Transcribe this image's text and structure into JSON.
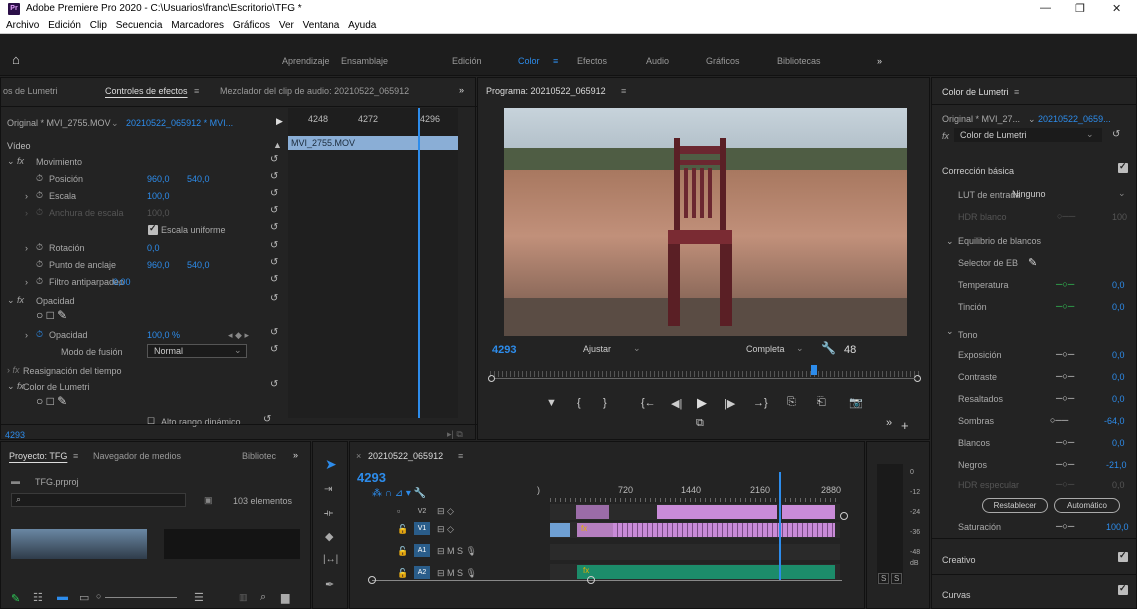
{
  "titlebar": {
    "app_icon": "Pr",
    "title": "Adobe Premiere Pro 2020 - C:\\Usuarios\\franc\\Escritorio\\TFG *",
    "minimize": "—",
    "maximize": "❐",
    "close": "✕"
  },
  "menu": [
    "Archivo",
    "Edición",
    "Clip",
    "Secuencia",
    "Marcadores",
    "Gráficos",
    "Ver",
    "Ventana",
    "Ayuda"
  ],
  "workspaces": {
    "home_icon": "⌂",
    "items": [
      "Aprendizaje",
      "Ensamblaje",
      "Edición",
      "Color",
      "Efectos",
      "Audio",
      "Gráficos",
      "Bibliotecas"
    ],
    "active": "Color",
    "more": "»"
  },
  "effects_panel": {
    "tabs": [
      "os de Lumetri",
      "Controles de efectos",
      "Mezclador del clip de audio: 20210522_065912"
    ],
    "active_tab": "Controles de efectos",
    "menu_icon": "≡",
    "more": "»",
    "source_clip": "Original * MVI_2755.MOV",
    "sequence_clip": "20210522_065912 * MVI...",
    "timecodes": [
      "4248",
      "4272",
      "4296"
    ],
    "timeline_clip": "MVI_2755.MOV",
    "section_video": "Vídeo",
    "motion": {
      "label": "Movimiento",
      "position_label": "Posición",
      "position_x": "960,0",
      "position_y": "540,0",
      "scale_label": "Escala",
      "scale_value": "100,0",
      "scale_width_label": "Anchura de escala",
      "scale_width_value": "100,0",
      "uniform_label": "Escala uniforme",
      "rotation_label": "Rotación",
      "rotation_value": "0,0",
      "anchor_label": "Punto de anclaje",
      "anchor_x": "960,0",
      "anchor_y": "540,0",
      "flicker_label": "Filtro antiparpadeo",
      "flicker_value": "0,00"
    },
    "opacity": {
      "label": "Opacidad",
      "opacity_label": "Opacidad",
      "opacity_value": "100,0 %",
      "blend_label": "Modo de fusión",
      "blend_value": "Normal"
    },
    "time_remap": "Reasignación del tiempo",
    "lumetri": "Color de Lumetri",
    "hdr_label": "Alto rango dinámico",
    "current_time": "4293"
  },
  "program_monitor": {
    "title": "Programa: 20210522_065912",
    "timecode": "4293",
    "fit": "Ajustar",
    "quality": "Completa",
    "duration": "48",
    "controls": [
      "▼",
      "{",
      "}",
      "{←",
      "◀|",
      "▶",
      "|▶",
      "→}",
      "⎘",
      "⎗",
      "📷"
    ],
    "more": "»",
    "add": "+"
  },
  "project_panel": {
    "tabs": [
      "Proyecto: TFG",
      "Navegador de medios",
      "Bibliotec"
    ],
    "project_file": "TFG.prproj",
    "count": "103 elementos"
  },
  "timeline": {
    "title": "20210522_065912",
    "timecode": "4293",
    "ruler": [
      "720",
      "1440",
      "2160",
      "2880"
    ],
    "tracks": [
      "V2",
      "V1",
      "A1",
      "A2"
    ],
    "meter_scale": [
      "0",
      "-12",
      "-24",
      "-36",
      "-48",
      "dB"
    ],
    "solo": [
      "S",
      "S"
    ]
  },
  "lumetri": {
    "title": "Color de Lumetri",
    "source": "Original * MVI_27...",
    "sequence": "20210522_0659...",
    "effect": "Color de Lumetri",
    "basic": "Corrección básica",
    "lut_label": "LUT de entrada",
    "lut_value": "Ninguno",
    "hdr_white_label": "HDR blanco",
    "hdr_white_value": "100",
    "wb_label": "Equilibrio de blancos",
    "wb_selector": "Selector de EB",
    "temp_label": "Temperatura",
    "temp_value": "0,0",
    "tint_label": "Tinción",
    "tint_value": "0,0",
    "tone_label": "Tono",
    "exposure_label": "Exposición",
    "exposure_value": "0,0",
    "contrast_label": "Contraste",
    "contrast_value": "0,0",
    "highlights_label": "Resaltados",
    "highlights_value": "0,0",
    "shadows_label": "Sombras",
    "shadows_value": "-64,0",
    "whites_label": "Blancos",
    "whites_value": "0,0",
    "blacks_label": "Negros",
    "blacks_value": "-21,0",
    "hdr_specular_label": "HDR especular",
    "hdr_specular_value": "0,0",
    "reset_btn": "Restablecer",
    "auto_btn": "Automático",
    "saturation_label": "Saturación",
    "saturation_value": "100,0",
    "creative": "Creativo",
    "curves": "Curvas"
  },
  "colors": {
    "accent": "#2d8ceb",
    "clip_video": "#c98bd8",
    "clip_audio": "#1c8c6a",
    "playhead": "#2d8ceb"
  }
}
